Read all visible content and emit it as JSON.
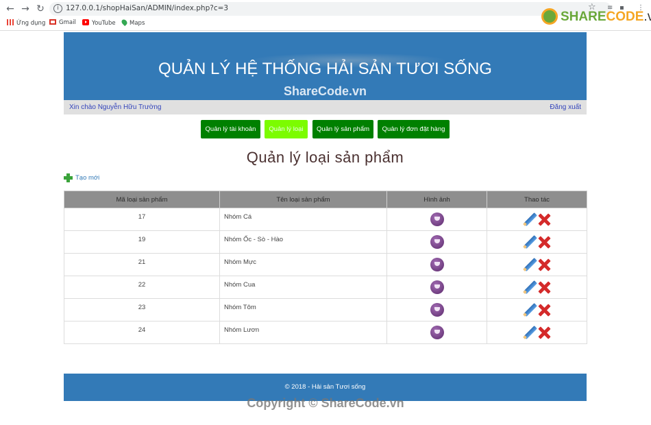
{
  "browser": {
    "url": "127.0.0.1/shopHaiSan/ADMIN/index.php?c=3",
    "bookmarks": [
      "Ứng dụng",
      "Gmail",
      "YouTube",
      "Maps"
    ]
  },
  "logo": {
    "part1": "SHARE",
    "part2": "CODE",
    "part3": ".vn"
  },
  "header": {
    "title": "QUẢN LÝ HỆ THỐNG HẢI SẢN TƯƠI SỐNG",
    "watermark": "ShareCode.vn"
  },
  "userbar": {
    "greeting": "Xin chào Nguyễn Hữu Trường",
    "logout": "Đăng xuất"
  },
  "menu": [
    {
      "label": "Quản lý tài khoản",
      "active": false
    },
    {
      "label": "Quản lý loại",
      "active": true
    },
    {
      "label": "Quản lý sản phẩm",
      "active": false
    },
    {
      "label": "Quản lý đơn đặt hàng",
      "active": false
    }
  ],
  "page_title": "Quản lý loại sản phẩm",
  "create_link": "Tạo mới",
  "table": {
    "headers": [
      "Mã loại sản phẩm",
      "Tên loại sản phẩm",
      "Hình ảnh",
      "Thao tác"
    ],
    "rows": [
      {
        "id": "17",
        "name": "Nhóm Cá"
      },
      {
        "id": "19",
        "name": "Nhóm Ốc - Sò - Hào"
      },
      {
        "id": "21",
        "name": "Nhóm Mực"
      },
      {
        "id": "22",
        "name": "Nhóm Cua"
      },
      {
        "id": "23",
        "name": "Nhóm Tôm"
      },
      {
        "id": "24",
        "name": "Nhóm Lươn"
      }
    ]
  },
  "footer": "© 2018 - Hải sản Tươi sống",
  "watermark_bottom": "Copyright © ShareCode.vn",
  "colors": {
    "primary": "#337ab7",
    "menu_button": "#008000",
    "menu_active": "#7cfc00"
  }
}
